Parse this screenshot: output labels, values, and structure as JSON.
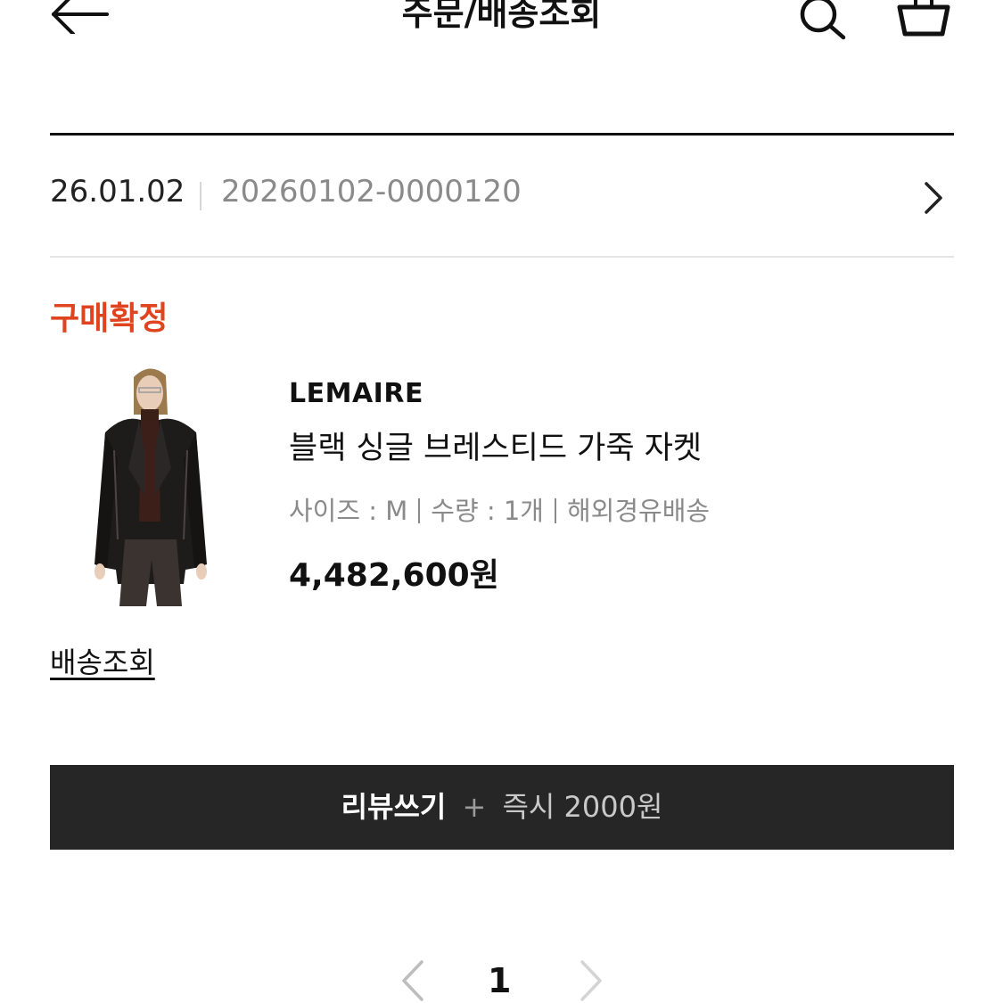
{
  "header": {
    "title": "주문/배송조회",
    "back_icon": "arrow-left-icon",
    "search_icon": "search-icon",
    "cart_icon": "basket-icon"
  },
  "order": {
    "date": "26.01.02",
    "number": "20260102-0000120"
  },
  "status": {
    "label": "구매확정",
    "color": "#e0441f"
  },
  "product": {
    "brand": "LEMAIRE",
    "name": "블랙 싱글 브레스티드 가죽 자켓",
    "size": "사이즈 : M",
    "quantity": "수량 : 1개",
    "shipping": "해외경유배송",
    "price": "4,482,600원"
  },
  "links": {
    "track": "배송조회"
  },
  "review_button": {
    "label": "리뷰쓰기",
    "plus": "+",
    "reward": "즉시 2000원"
  },
  "pagination": {
    "current": "1"
  }
}
